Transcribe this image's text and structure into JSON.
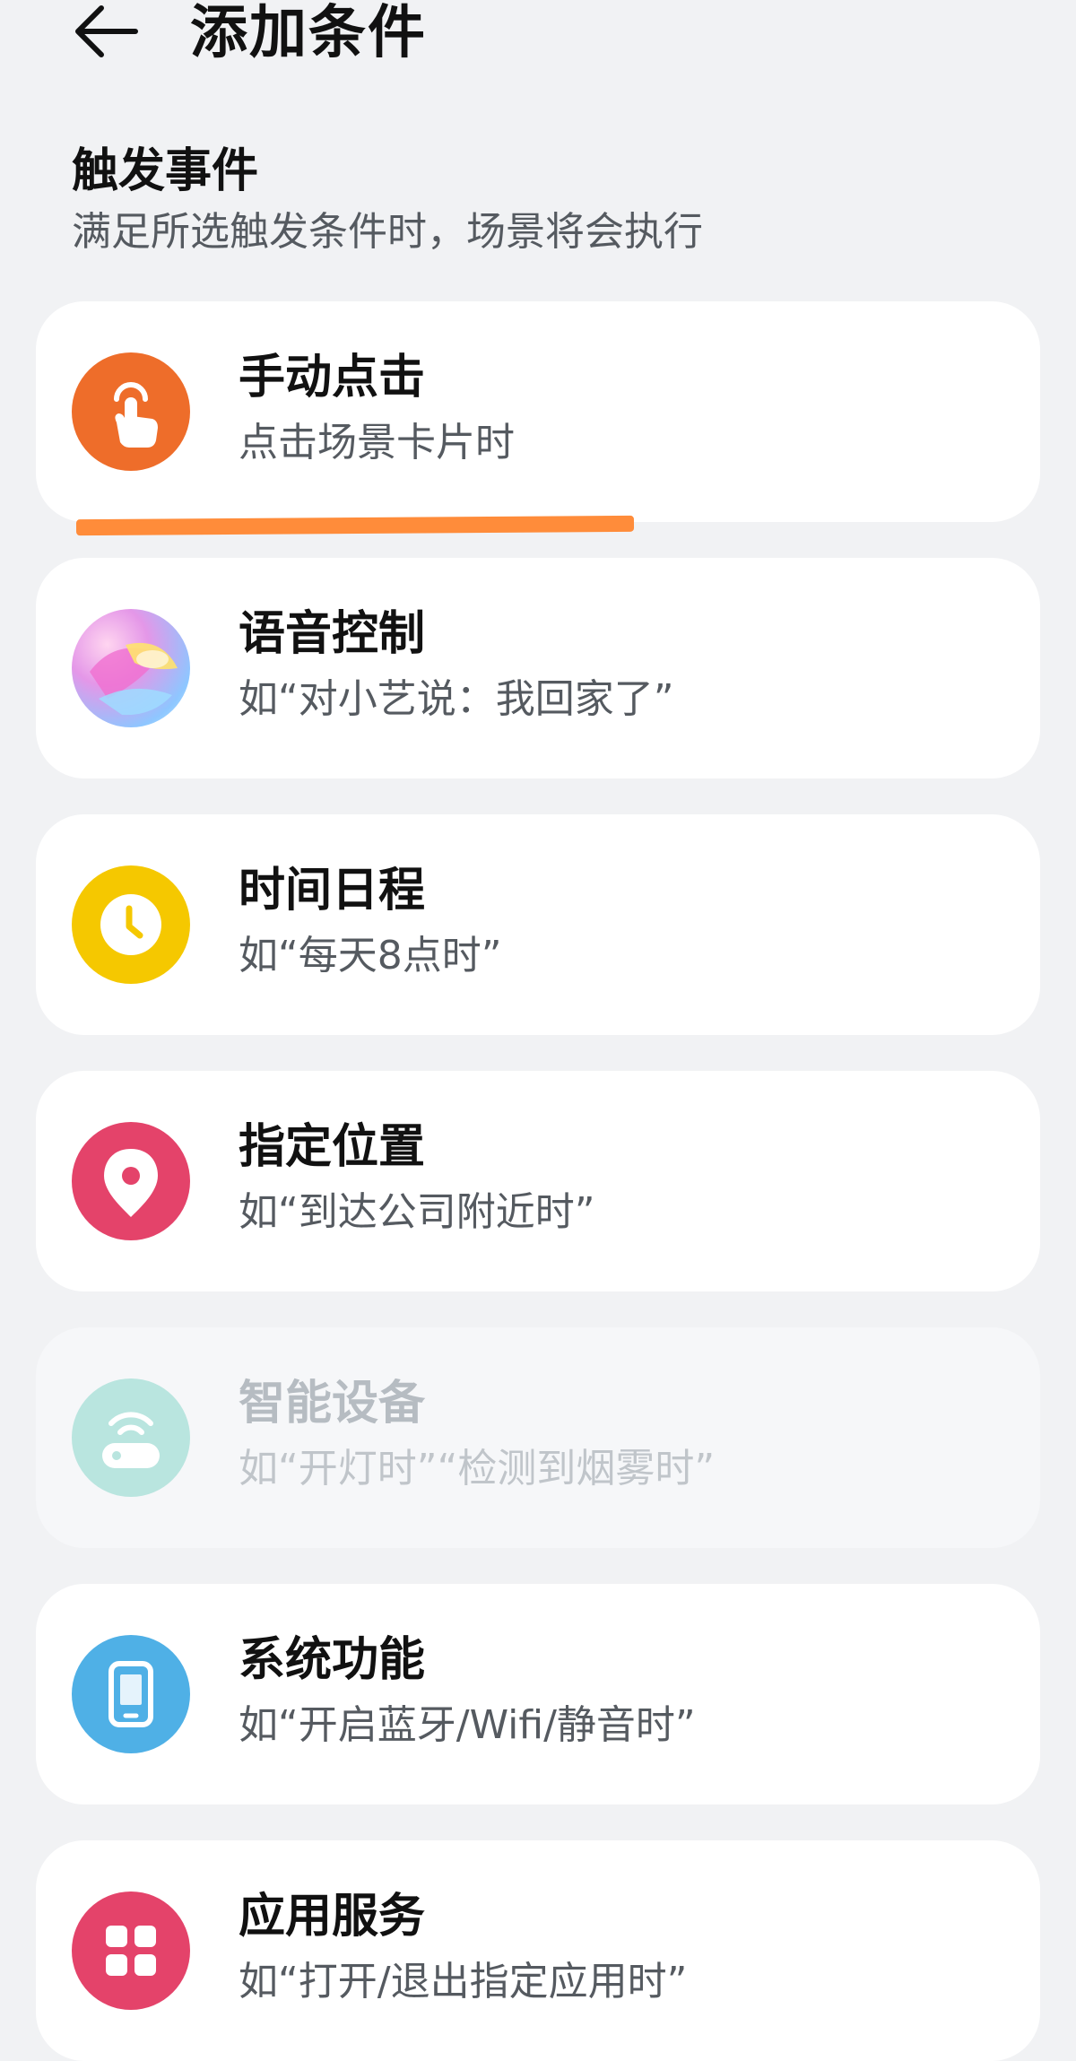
{
  "header": {
    "title": "添加条件",
    "back_icon": "arrow-left-icon"
  },
  "section": {
    "title": "触发事件",
    "subtitle": "满足所选触发条件时，场景将会执行"
  },
  "items": [
    {
      "title": "手动点击",
      "subtitle": "点击场景卡片时",
      "icon": "tap-hand-icon",
      "color": "#ee6d2a",
      "enabled": true
    },
    {
      "title": "语音控制",
      "subtitle": "如“对小艺说：我回家了”",
      "icon": "voice-assistant-icon",
      "color": "#c58fe8",
      "enabled": true
    },
    {
      "title": "时间日程",
      "subtitle": "如“每天8点时”",
      "icon": "clock-icon",
      "color": "#f5c800",
      "enabled": true
    },
    {
      "title": "指定位置",
      "subtitle": "如“到达公司附近时”",
      "icon": "location-pin-icon",
      "color": "#e4436a",
      "enabled": true
    },
    {
      "title": "智能设备",
      "subtitle": "如“开灯时”“检测到烟雾时”",
      "icon": "smart-device-icon",
      "color": "#b9e5df",
      "enabled": false
    },
    {
      "title": "系统功能",
      "subtitle": "如“开启蓝牙/Wifi/静音时”",
      "icon": "phone-icon",
      "color": "#4fb0e6",
      "enabled": true
    },
    {
      "title": "应用服务",
      "subtitle": "如“打开/退出指定应用时”",
      "icon": "apps-grid-icon",
      "color": "#e4436a",
      "enabled": true
    }
  ],
  "colors": {
    "background": "#f1f2f4",
    "card": "#ffffff",
    "highlight": "#ff8c3a"
  }
}
